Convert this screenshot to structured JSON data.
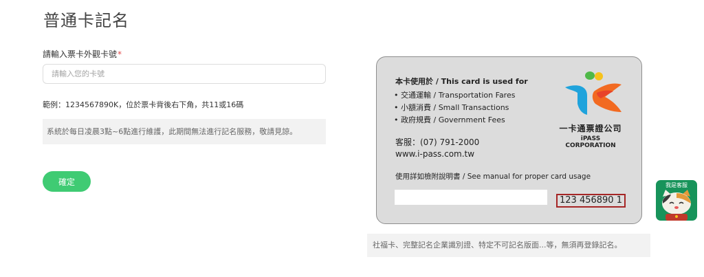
{
  "page": {
    "title": "普通卡記名"
  },
  "form": {
    "label": "請輸入票卡外觀卡號",
    "required_mark": "*",
    "placeholder": "請輸入您的卡號",
    "value": "",
    "example": "範例：1234567890K，位於票卡背後右下角，共11或16碼",
    "notice": "系統於每日凌晨3點~6點進行維護，此期間無法進行記名服務，敬請見諒。",
    "confirm_label": "確定"
  },
  "card": {
    "used_title": "本卡使用於 / This card is used for",
    "uses": [
      {
        "bullet": "•",
        "text": "交通運輸 / Transportation Fares"
      },
      {
        "bullet": "•",
        "text": "小額消費 / Small Transactions"
      },
      {
        "bullet": "•",
        "text": "政府規費 / Government Fees"
      }
    ],
    "service": "客服：(07) 791-2000",
    "website": "www.i-pass.com.tw",
    "manual": "使用詳如檢附說明書 / See manual for proper card usage",
    "number": "123 456890 1",
    "logo_cn": "一卡通票證公司",
    "logo_en": "iPASS CORPORATION",
    "logo_icon": "ipass-logo-icon"
  },
  "card_note": "社福卡、完整記名企業識別證、特定不可記名版面...等，無須再登錄記名。",
  "cs_widget": {
    "label": "我是客服",
    "icon": "cat-mascot-icon"
  },
  "colors": {
    "accent": "#3fcb73",
    "required": "#e24a4a",
    "card_bg": "#dcdcdc",
    "card_number_border": "#a52525",
    "cs_bg": "#17935a"
  }
}
